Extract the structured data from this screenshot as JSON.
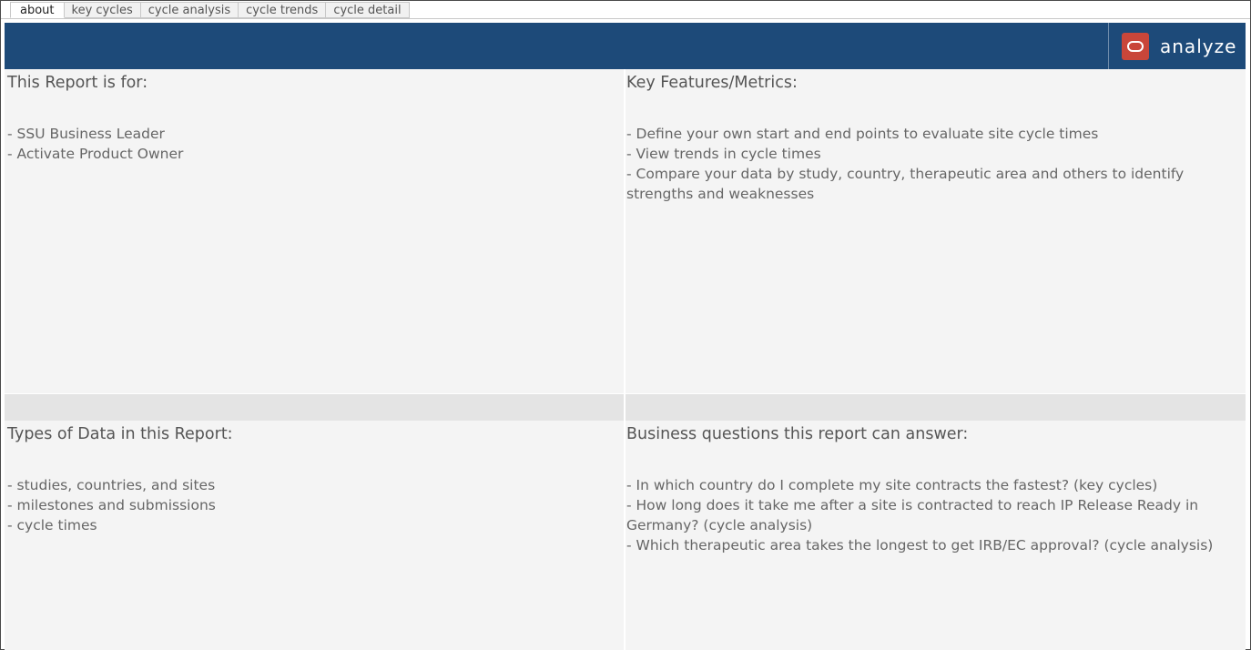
{
  "tabs": [
    {
      "label": "about",
      "active": true
    },
    {
      "label": "key cycles",
      "active": false
    },
    {
      "label": "cycle analysis",
      "active": false
    },
    {
      "label": "cycle trends",
      "active": false
    },
    {
      "label": "cycle detail",
      "active": false
    }
  ],
  "banner": {
    "color": "#1d4a79",
    "logo_text": "analyze",
    "logo_color": "#c9463a"
  },
  "panels": {
    "report_for": {
      "title": "This Report is for:",
      "items": [
        "- SSU Business Leader",
        "- Activate Product Owner"
      ]
    },
    "key_features": {
      "title": "Key Features/Metrics:",
      "items": [
        "- Define your own start and end points to evaluate site cycle times",
        "- View trends in cycle times",
        "- Compare your data by study, country, therapeutic area and others to identify strengths and weaknesses"
      ]
    },
    "data_types": {
      "title": "Types of Data in this Report:",
      "items": [
        "- studies, countries, and sites",
        "- milestones and submissions",
        "- cycle times"
      ]
    },
    "business_questions": {
      "title": "Business questions this report can answer:",
      "items": [
        "- In which country do I complete my site contracts the fastest? (key cycles)",
        "- How long does it take me after a site is contracted to reach IP Release Ready in Germany? (cycle analysis)",
        "- Which therapeutic area takes the longest to get IRB/EC approval? (cycle analysis)"
      ]
    }
  }
}
